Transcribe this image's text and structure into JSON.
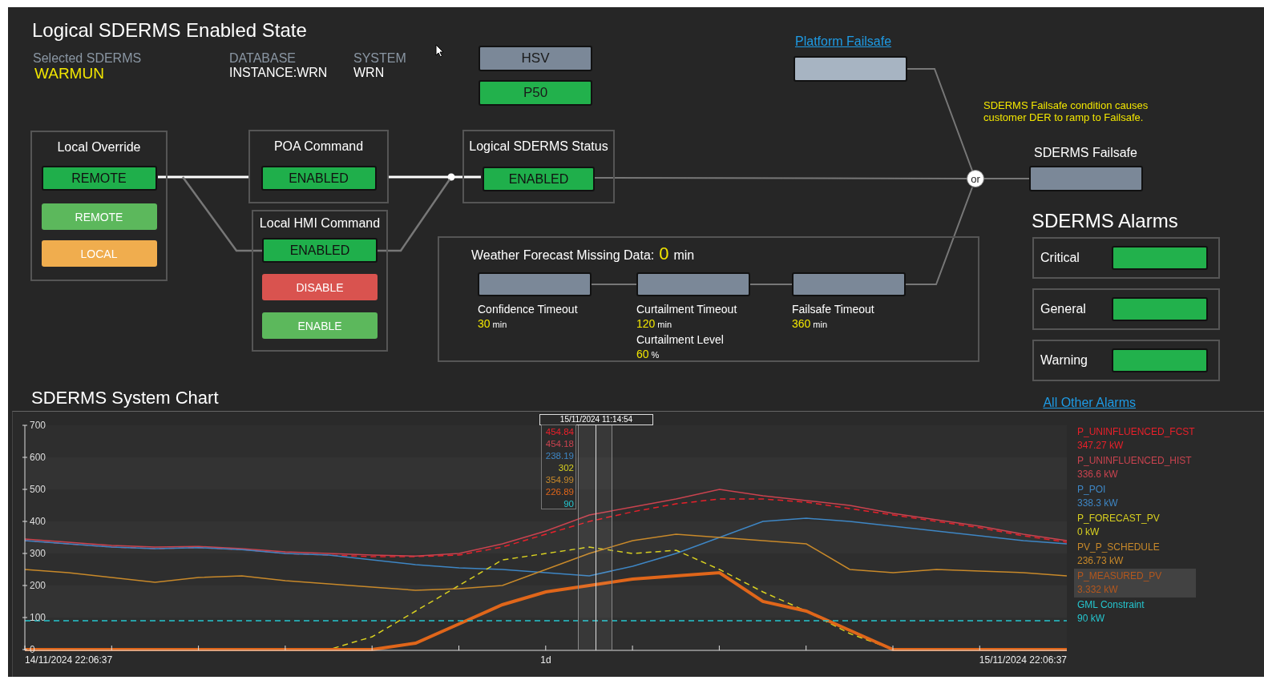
{
  "header": {
    "title": "Logical SDERMS Enabled State",
    "selected_label": "Selected SDERMS",
    "selected_value": "WARMUN",
    "database_label": "DATABASE",
    "database_value": "INSTANCE:WRN",
    "system_label": "SYSTEM",
    "system_value": "WRN"
  },
  "mode_buttons": [
    {
      "label": "HSV",
      "color": "#7b8898"
    },
    {
      "label": "P50",
      "color": "#22b14c"
    }
  ],
  "local_override": {
    "title": "Local Override",
    "status": "REMOTE",
    "buttons": [
      {
        "label": "REMOTE",
        "kind": "remote"
      },
      {
        "label": "LOCAL",
        "kind": "local"
      }
    ]
  },
  "poa_command": {
    "title": "POA Command",
    "status": "ENABLED"
  },
  "local_hmi_command": {
    "title": "Local HMI Command",
    "status": "ENABLED",
    "buttons": [
      {
        "label": "DISABLE",
        "kind": "disable"
      },
      {
        "label": "ENABLE",
        "kind": "enable"
      }
    ]
  },
  "logical_status": {
    "title": "Logical SDERMS Status",
    "status": "ENABLED"
  },
  "platform_failsafe": {
    "link": "Platform Failsafe"
  },
  "failsafe_note": [
    "SDERMS Failsafe condition causes",
    "customer DER to ramp to Failsafe."
  ],
  "or_gate": "or",
  "sderms_failsafe": {
    "title": "SDERMS Failsafe"
  },
  "weather": {
    "title": "Weather Forecast Missing Data:",
    "value": "0",
    "unit": "min",
    "timers": [
      {
        "label": "Confidence Timeout",
        "value": "30",
        "unit": "min"
      },
      {
        "label": "Curtailment Timeout",
        "value": "120",
        "unit": "min",
        "sub_label": "Curtailment Level",
        "sub_value": "60",
        "sub_unit": "%"
      },
      {
        "label": "Failsafe Timeout",
        "value": "360",
        "unit": "min"
      }
    ]
  },
  "alarms": {
    "title": "SDERMS Alarms",
    "items": [
      {
        "label": "Critical",
        "color": "#22b14c"
      },
      {
        "label": "General",
        "color": "#22b14c"
      },
      {
        "label": "Warning",
        "color": "#22b14c"
      }
    ],
    "link": "All Other Alarms"
  },
  "chart_section": {
    "title": "SDERMS System Chart",
    "chart_data": {
      "type": "line",
      "categories": [
        null,
        null,
        null,
        null,
        null,
        null,
        null,
        null,
        null,
        null,
        null,
        null,
        null,
        null,
        null,
        null,
        null,
        null,
        null,
        null,
        null,
        null,
        null,
        null,
        null
      ],
      "ylim": [
        0,
        700
      ],
      "yticks": [
        0,
        100,
        200,
        300,
        400,
        500,
        600,
        700
      ],
      "series": [
        {
          "name": "P_UNINFLUENCED_FCST",
          "color": "#e8202a",
          "line_style": "dashed",
          "values": [
            340,
            330,
            320,
            315,
            318,
            312,
            300,
            295,
            290,
            290,
            295,
            320,
            360,
            400,
            430,
            455,
            470,
            470,
            460,
            440,
            420,
            400,
            380,
            355,
            335
          ]
        },
        {
          "name": "P_UNINFLUENCED_HIST",
          "color": "#c9434f",
          "line_style": "solid",
          "values": [
            345,
            335,
            325,
            320,
            322,
            315,
            305,
            300,
            295,
            292,
            300,
            330,
            370,
            420,
            445,
            470,
            500,
            480,
            465,
            450,
            425,
            405,
            385,
            360,
            340
          ]
        },
        {
          "name": "P_POI",
          "color": "#3e86c4",
          "line_style": "solid",
          "values": [
            340,
            330,
            320,
            315,
            318,
            312,
            300,
            295,
            280,
            265,
            255,
            250,
            240,
            230,
            260,
            300,
            350,
            400,
            410,
            400,
            385,
            370,
            355,
            340,
            330
          ]
        },
        {
          "name": "P_FORECAST_PV",
          "color": "#d8d020",
          "line_style": "dashed",
          "values": [
            null,
            null,
            null,
            null,
            null,
            null,
            0,
            0,
            40,
            120,
            200,
            280,
            300,
            320,
            300,
            310,
            250,
            180,
            120,
            50,
            0,
            0,
            null,
            null,
            null
          ]
        },
        {
          "name": "PV_P_SCHEDULE",
          "color": "#c8892a",
          "line_style": "solid",
          "values": [
            250,
            240,
            225,
            210,
            225,
            230,
            215,
            205,
            195,
            185,
            190,
            200,
            250,
            300,
            340,
            360,
            350,
            340,
            330,
            250,
            240,
            250,
            245,
            240,
            230
          ]
        },
        {
          "name": "P_MEASURED_PV",
          "color": "#e0661a",
          "line_style": "solid",
          "values": [
            0,
            0,
            0,
            0,
            0,
            0,
            0,
            0,
            0,
            20,
            80,
            140,
            180,
            200,
            220,
            230,
            240,
            150,
            120,
            60,
            0,
            0,
            0,
            0,
            0
          ]
        },
        {
          "name": "GML Constraint",
          "color": "#25c6cf",
          "line_style": "dashed",
          "values": [
            90,
            90,
            90,
            90,
            90,
            90,
            90,
            90,
            90,
            90,
            90,
            90,
            90,
            90,
            90,
            90,
            90,
            90,
            90,
            90,
            90,
            90,
            90,
            90,
            90
          ]
        }
      ]
    },
    "axis_labels": [
      "14/11/2024 22:06:37",
      "1d",
      "15/11/2024 22:06:37"
    ],
    "tooltip": {
      "time": "15/11/2024 11:14:54",
      "values": [
        "454.84",
        "454.18",
        "238.19",
        "302",
        "354.99",
        "226.89",
        "90"
      ]
    },
    "legend": [
      {
        "reading": "347.27 kW",
        "selected": false
      },
      {
        "reading": "336.6 kW",
        "selected": false
      },
      {
        "reading": "338.3 kW",
        "selected": false
      },
      {
        "reading": "0 kW",
        "selected": false
      },
      {
        "reading": "236.73 kW",
        "selected": false
      },
      {
        "reading": "3.332 kW",
        "selected": true
      },
      {
        "reading": "90 kW",
        "selected": false
      }
    ]
  }
}
